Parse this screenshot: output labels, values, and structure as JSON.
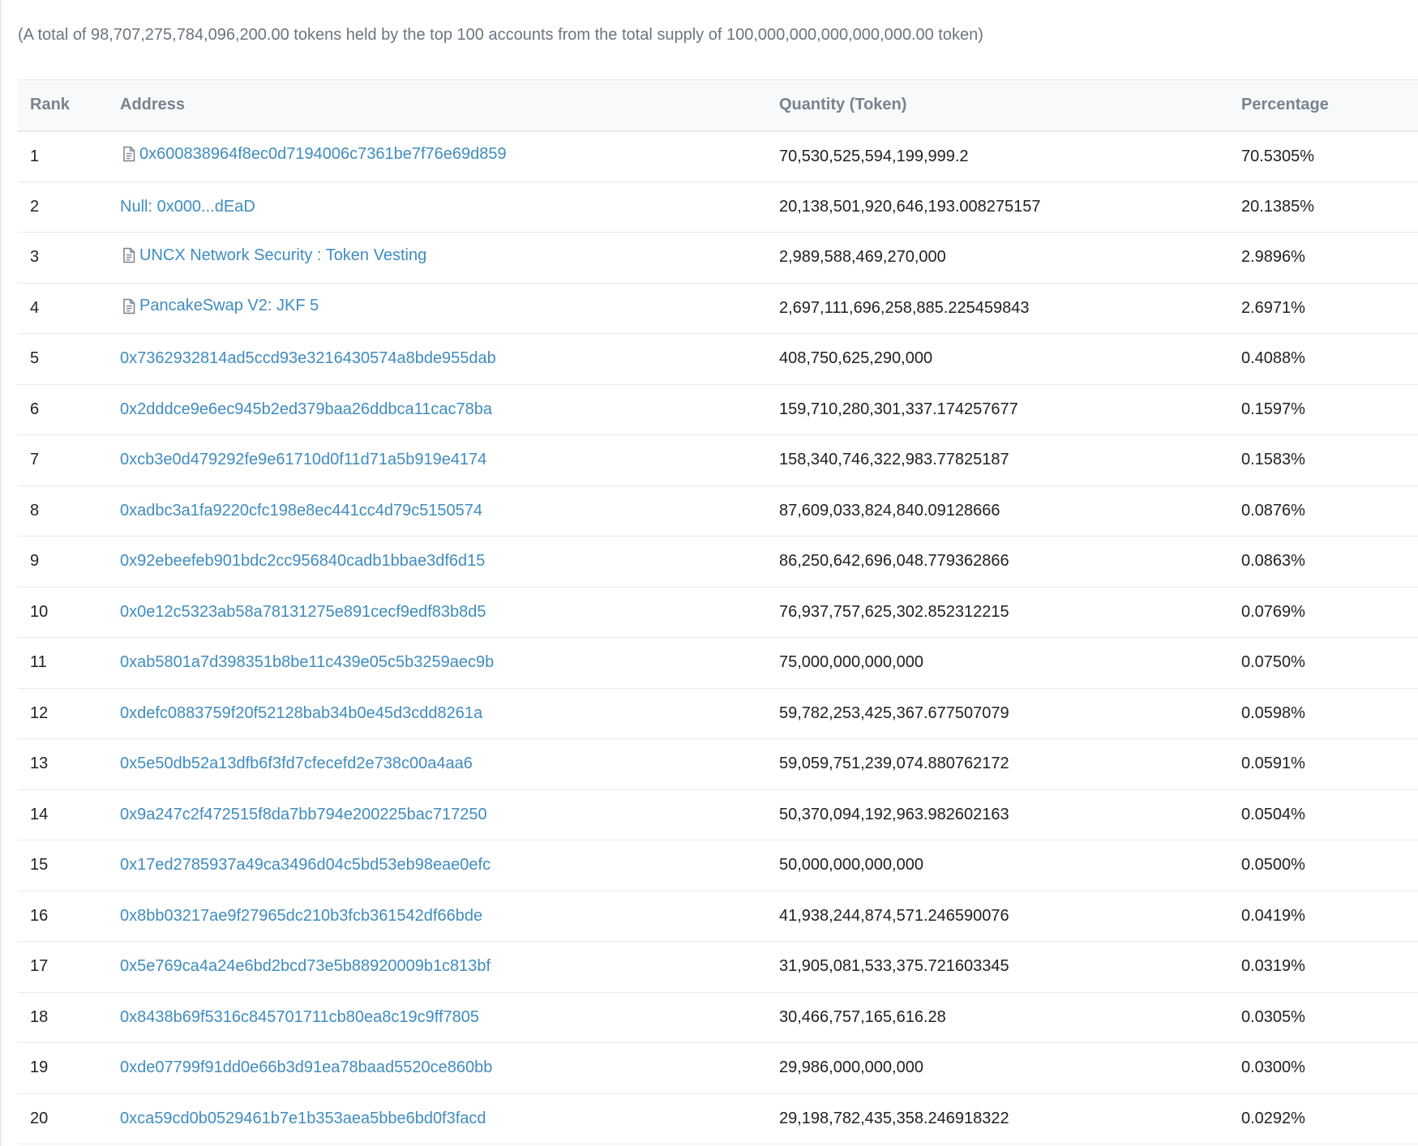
{
  "summary": "(A total of 98,707,275,784,096,200.00 tokens held by the top 100 accounts from the total supply of 100,000,000,000,000,000.00 token)",
  "table": {
    "headers": {
      "rank": "Rank",
      "address": "Address",
      "quantity": "Quantity (Token)",
      "percentage": "Percentage"
    },
    "rows": [
      {
        "rank": "1",
        "address": "0x600838964f8ec0d7194006c7361be7f76e69d859",
        "contract": true,
        "quantity": "70,530,525,594,199,999.2",
        "percentage": "70.5305%"
      },
      {
        "rank": "2",
        "address": "Null: 0x000...dEaD",
        "contract": false,
        "quantity": "20,138,501,920,646,193.008275157",
        "percentage": "20.1385%"
      },
      {
        "rank": "3",
        "address": "UNCX Network Security : Token Vesting",
        "contract": true,
        "quantity": "2,989,588,469,270,000",
        "percentage": "2.9896%"
      },
      {
        "rank": "4",
        "address": "PancakeSwap V2: JKF 5",
        "contract": true,
        "quantity": "2,697,111,696,258,885.225459843",
        "percentage": "2.6971%"
      },
      {
        "rank": "5",
        "address": "0x7362932814ad5ccd93e3216430574a8bde955dab",
        "contract": false,
        "quantity": "408,750,625,290,000",
        "percentage": "0.4088%"
      },
      {
        "rank": "6",
        "address": "0x2dddce9e6ec945b2ed379baa26ddbca11cac78ba",
        "contract": false,
        "quantity": "159,710,280,301,337.174257677",
        "percentage": "0.1597%"
      },
      {
        "rank": "7",
        "address": "0xcb3e0d479292fe9e61710d0f11d71a5b919e4174",
        "contract": false,
        "quantity": "158,340,746,322,983.77825187",
        "percentage": "0.1583%"
      },
      {
        "rank": "8",
        "address": "0xadbc3a1fa9220cfc198e8ec441cc4d79c5150574",
        "contract": false,
        "quantity": "87,609,033,824,840.09128666",
        "percentage": "0.0876%"
      },
      {
        "rank": "9",
        "address": "0x92ebeefeb901bdc2cc956840cadb1bbae3df6d15",
        "contract": false,
        "quantity": "86,250,642,696,048.779362866",
        "percentage": "0.0863%"
      },
      {
        "rank": "10",
        "address": "0x0e12c5323ab58a78131275e891cecf9edf83b8d5",
        "contract": false,
        "quantity": "76,937,757,625,302.852312215",
        "percentage": "0.0769%"
      },
      {
        "rank": "11",
        "address": "0xab5801a7d398351b8be11c439e05c5b3259aec9b",
        "contract": false,
        "quantity": "75,000,000,000,000",
        "percentage": "0.0750%"
      },
      {
        "rank": "12",
        "address": "0xdefc0883759f20f52128bab34b0e45d3cdd8261a",
        "contract": false,
        "quantity": "59,782,253,425,367.677507079",
        "percentage": "0.0598%"
      },
      {
        "rank": "13",
        "address": "0x5e50db52a13dfb6f3fd7cfecefd2e738c00a4aa6",
        "contract": false,
        "quantity": "59,059,751,239,074.880762172",
        "percentage": "0.0591%"
      },
      {
        "rank": "14",
        "address": "0x9a247c2f472515f8da7bb794e200225bac717250",
        "contract": false,
        "quantity": "50,370,094,192,963.982602163",
        "percentage": "0.0504%"
      },
      {
        "rank": "15",
        "address": "0x17ed2785937a49ca3496d04c5bd53eb98eae0efc",
        "contract": false,
        "quantity": "50,000,000,000,000",
        "percentage": "0.0500%"
      },
      {
        "rank": "16",
        "address": "0x8bb03217ae9f27965dc210b3fcb361542df66bde",
        "contract": false,
        "quantity": "41,938,244,874,571.246590076",
        "percentage": "0.0419%"
      },
      {
        "rank": "17",
        "address": "0x5e769ca4a24e6bd2bcd73e5b88920009b1c813bf",
        "contract": false,
        "quantity": "31,905,081,533,375.721603345",
        "percentage": "0.0319%"
      },
      {
        "rank": "18",
        "address": "0x8438b69f5316c845701711cb80ea8c19c9ff7805",
        "contract": false,
        "quantity": "30,466,757,165,616.28",
        "percentage": "0.0305%"
      },
      {
        "rank": "19",
        "address": "0xde07799f91dd0e66b3d91ea78baad5520ce860bb",
        "contract": false,
        "quantity": "29,986,000,000,000",
        "percentage": "0.0300%"
      },
      {
        "rank": "20",
        "address": "0xca59cd0b0529461b7e1b353aea5bbe6bd0f3facd",
        "contract": false,
        "quantity": "29,198,782,435,358.246918322",
        "percentage": "0.0292%"
      }
    ]
  }
}
